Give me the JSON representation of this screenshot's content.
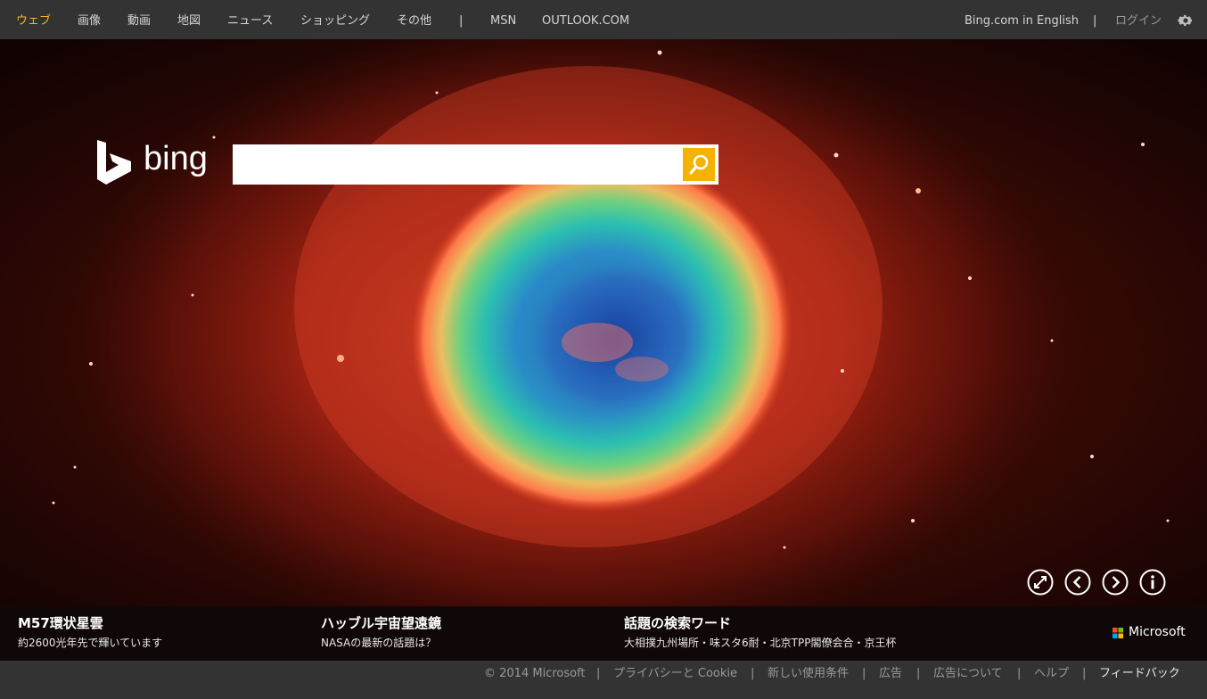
{
  "nav": {
    "items": [
      {
        "label": "ウェブ",
        "active": true
      },
      {
        "label": "画像"
      },
      {
        "label": "動画"
      },
      {
        "label": "地図"
      },
      {
        "label": "ニュース"
      },
      {
        "label": "ショッピング"
      },
      {
        "label": "その他"
      }
    ],
    "separator": "|",
    "links": [
      "MSN",
      "OUTLOOK.COM"
    ],
    "english_link": "Bing.com in English",
    "login": "ログイン",
    "settings_icon": "gear-icon"
  },
  "logo": {
    "text": "bing"
  },
  "search": {
    "value": "",
    "placeholder": "",
    "button_icon": "search-icon"
  },
  "controls": [
    "fullscreen-icon",
    "previous-icon",
    "next-icon",
    "info-icon"
  ],
  "info": {
    "items": [
      {
        "title": "M57環状星雲",
        "subtitle": "約2600光年先で輝いています"
      },
      {
        "title": "ハッブル宇宙望遠鏡",
        "subtitle": "NASAの最新の話題は？"
      },
      {
        "title": "話題の検索ワード",
        "subtitle": "大相撲九州場所・味スタ6耐・北京TPP閣僚会合・京王杯"
      }
    ],
    "brand": "Microsoft"
  },
  "footer": {
    "copyright": "© 2014 Microsoft",
    "separator": "|",
    "links": [
      "プライバシーと Cookie",
      "新しい使用条件",
      "広告",
      "広告について",
      "ヘルプ",
      "フィードバック"
    ]
  },
  "colors": {
    "accent": "#f4b300",
    "active_nav": "#f4b532",
    "bar": "#333333"
  }
}
